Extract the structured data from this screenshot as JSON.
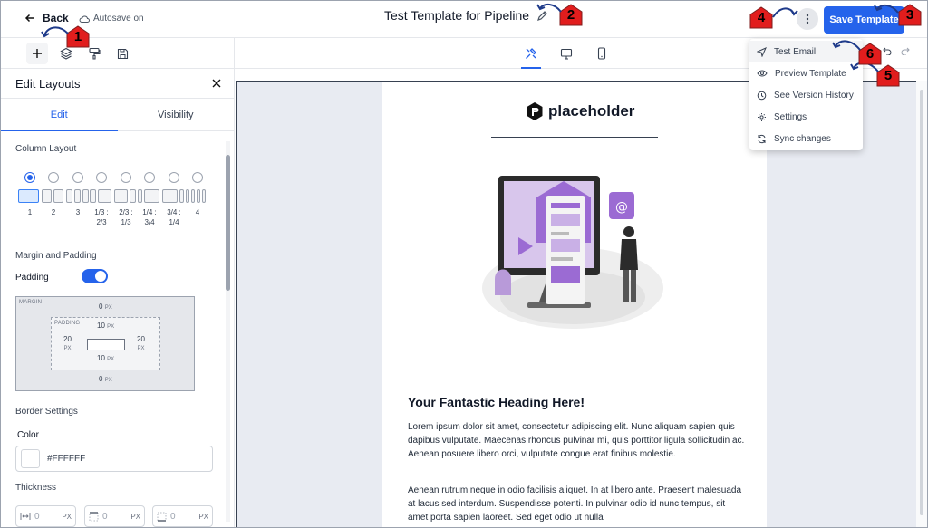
{
  "header": {
    "back_label": "Back",
    "autosave_label": "Autosave on",
    "title": "Test Template for Pipeline",
    "save_label": "Save Template"
  },
  "toolbar": {
    "left_icons": [
      "plus-icon",
      "layers-icon",
      "paint-roller-icon",
      "save-icon"
    ],
    "device_icons": [
      "design-tools-icon",
      "desktop-icon",
      "mobile-icon"
    ]
  },
  "panel": {
    "title": "Edit Layouts",
    "tabs": [
      "Edit",
      "Visibility"
    ],
    "column_layout_label": "Column Layout",
    "column_options": [
      "1",
      "2",
      "3",
      "1/3 : 2/3",
      "2/3 : 1/3",
      "1/4 : 3/4",
      "3/4 : 1/4",
      "4"
    ],
    "margin_padding_label": "Margin and Padding",
    "padding_label": "Padding",
    "box": {
      "margin_label": "MARGIN",
      "padding_label": "PADDING",
      "margin_top": "0",
      "margin_bottom": "0",
      "padding_top": "10",
      "padding_bottom": "10",
      "padding_left": "20",
      "padding_right": "20",
      "unit": "PX"
    },
    "border_settings_label": "Border Settings",
    "color_label": "Color",
    "color_value": "#FFFFFF",
    "thickness_label": "Thickness",
    "thickness": [
      {
        "value": "0",
        "unit": "PX"
      },
      {
        "value": "0",
        "unit": "PX"
      },
      {
        "value": "0",
        "unit": "PX"
      }
    ]
  },
  "menu": {
    "items": [
      "Test Email",
      "Preview Template",
      "See Version History",
      "Settings",
      "Sync changes"
    ]
  },
  "email": {
    "logo_text": "placeholder",
    "heading": "Your Fantastic Heading Here!",
    "para1": "Lorem ipsum dolor sit amet, consectetur adipiscing elit. Nunc aliquam sapien quis dapibus vulputate. Maecenas rhoncus pulvinar mi, quis porttitor ligula sollicitudin ac. Aenean posuere libero orci, vulputate congue erat finibus molestie.",
    "para2": "Aenean rutrum neque in odio facilisis aliquet. In at libero ante. Praesent malesuada at lacus sed interdum. Suspendisse potenti. In pulvinar odio id nunc tempus, sit amet porta sapien laoreet. Sed eget odio ut nulla"
  },
  "annotations": [
    "1",
    "2",
    "3",
    "4",
    "5",
    "6"
  ],
  "colors": {
    "accent": "#2563eb",
    "marker_red": "#e11d1d",
    "illustration_purple": "#9b6bd3",
    "canvas_bg": "#e8ebf2"
  }
}
